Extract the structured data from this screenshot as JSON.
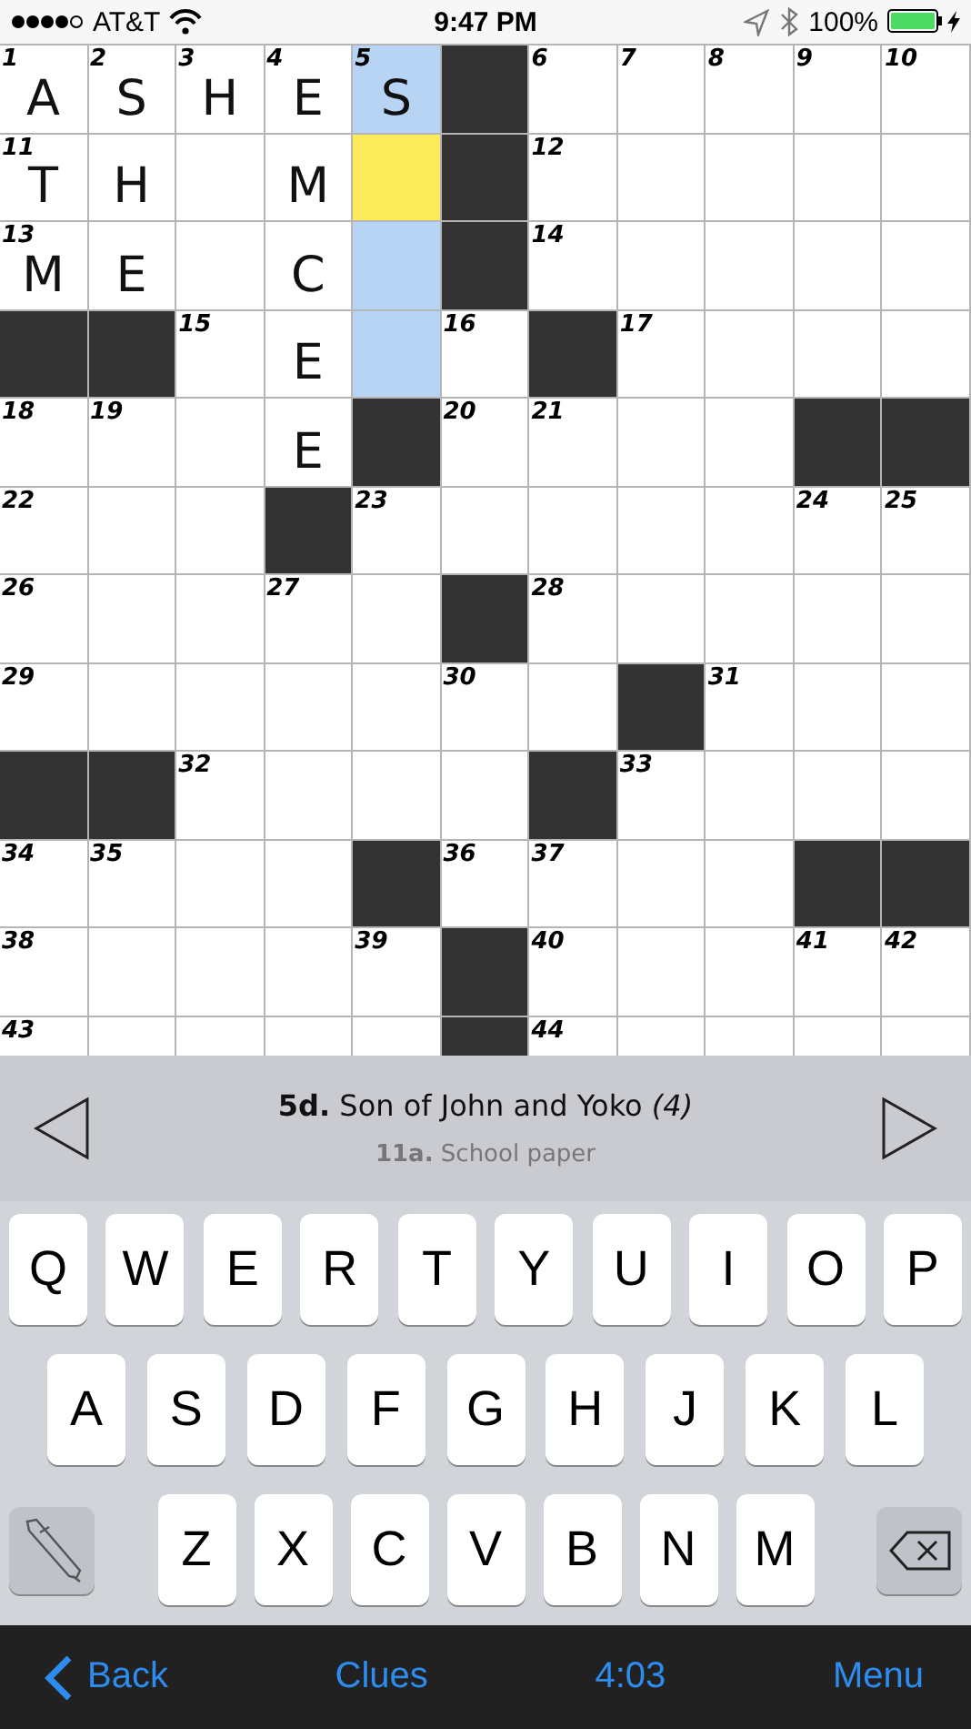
{
  "status_bar": {
    "carrier": "AT&T",
    "time": "9:47 PM",
    "battery": "100%"
  },
  "grid": {
    "rows": [
      [
        {
          "kind": "cell",
          "number": "1",
          "letter": "A",
          "selected": false,
          "highlighted": false
        },
        {
          "kind": "cell",
          "number": "2",
          "letter": "S",
          "selected": false,
          "highlighted": false
        },
        {
          "kind": "cell",
          "number": "3",
          "letter": "H",
          "selected": false,
          "highlighted": false
        },
        {
          "kind": "cell",
          "number": "4",
          "letter": "E",
          "selected": false,
          "highlighted": false
        },
        {
          "kind": "cell",
          "number": "5",
          "letter": "S",
          "selected": false,
          "highlighted": true
        },
        {
          "kind": "block"
        },
        {
          "kind": "cell",
          "number": "6",
          "selected": false,
          "highlighted": false
        },
        {
          "kind": "cell",
          "number": "7",
          "selected": false,
          "highlighted": false
        },
        {
          "kind": "cell",
          "number": "8",
          "selected": false,
          "highlighted": false
        },
        {
          "kind": "cell",
          "number": "9",
          "selected": false,
          "highlighted": false
        },
        {
          "kind": "cell",
          "number": "10",
          "selected": false,
          "highlighted": false
        }
      ],
      [
        {
          "kind": "cell",
          "number": "11",
          "letter": "T",
          "selected": false,
          "highlighted": false
        },
        {
          "kind": "cell",
          "letter": "H",
          "selected": false,
          "highlighted": false
        },
        {
          "kind": "cell",
          "selected": false,
          "highlighted": false
        },
        {
          "kind": "cell",
          "letter": "M",
          "selected": false,
          "highlighted": false
        },
        {
          "kind": "cell",
          "selected": true,
          "highlighted": false
        },
        {
          "kind": "block"
        },
        {
          "kind": "cell",
          "number": "12",
          "selected": false,
          "highlighted": false
        },
        {
          "kind": "cell",
          "selected": false,
          "highlighted": false
        },
        {
          "kind": "cell",
          "selected": false,
          "highlighted": false
        },
        {
          "kind": "cell",
          "selected": false,
          "highlighted": false
        },
        {
          "kind": "cell",
          "selected": false,
          "highlighted": false
        }
      ],
      [
        {
          "kind": "cell",
          "number": "13",
          "letter": "M",
          "selected": false,
          "highlighted": false
        },
        {
          "kind": "cell",
          "letter": "E",
          "selected": false,
          "highlighted": false
        },
        {
          "kind": "cell",
          "selected": false,
          "highlighted": false
        },
        {
          "kind": "cell",
          "letter": "C",
          "selected": false,
          "highlighted": false
        },
        {
          "kind": "cell",
          "selected": false,
          "highlighted": true
        },
        {
          "kind": "block"
        },
        {
          "kind": "cell",
          "number": "14",
          "selected": false,
          "highlighted": false
        },
        {
          "kind": "cell",
          "selected": false,
          "highlighted": false
        },
        {
          "kind": "cell",
          "selected": false,
          "highlighted": false
        },
        {
          "kind": "cell",
          "selected": false,
          "highlighted": false
        },
        {
          "kind": "cell",
          "selected": false,
          "highlighted": false
        }
      ],
      [
        {
          "kind": "block"
        },
        {
          "kind": "block"
        },
        {
          "kind": "cell",
          "number": "15",
          "selected": false,
          "highlighted": false
        },
        {
          "kind": "cell",
          "letter": "E",
          "selected": false,
          "highlighted": false
        },
        {
          "kind": "cell",
          "selected": false,
          "highlighted": true
        },
        {
          "kind": "cell",
          "number": "16",
          "selected": false,
          "highlighted": false
        },
        {
          "kind": "block"
        },
        {
          "kind": "cell",
          "number": "17",
          "selected": false,
          "highlighted": false
        },
        {
          "kind": "cell",
          "selected": false,
          "highlighted": false
        },
        {
          "kind": "cell",
          "selected": false,
          "highlighted": false
        },
        {
          "kind": "cell",
          "selected": false,
          "highlighted": false
        }
      ],
      [
        {
          "kind": "cell",
          "number": "18",
          "selected": false,
          "highlighted": false
        },
        {
          "kind": "cell",
          "number": "19",
          "selected": false,
          "highlighted": false
        },
        {
          "kind": "cell",
          "selected": false,
          "highlighted": false
        },
        {
          "kind": "cell",
          "letter": "E",
          "selected": false,
          "highlighted": false
        },
        {
          "kind": "block"
        },
        {
          "kind": "cell",
          "number": "20",
          "selected": false,
          "highlighted": false
        },
        {
          "kind": "cell",
          "number": "21",
          "selected": false,
          "highlighted": false
        },
        {
          "kind": "cell",
          "selected": false,
          "highlighted": false
        },
        {
          "kind": "cell",
          "selected": false,
          "highlighted": false
        },
        {
          "kind": "block"
        },
        {
          "kind": "block"
        }
      ],
      [
        {
          "kind": "cell",
          "number": "22",
          "selected": false,
          "highlighted": false
        },
        {
          "kind": "cell",
          "selected": false,
          "highlighted": false
        },
        {
          "kind": "cell",
          "selected": false,
          "highlighted": false
        },
        {
          "kind": "block"
        },
        {
          "kind": "cell",
          "number": "23",
          "selected": false,
          "highlighted": false
        },
        {
          "kind": "cell",
          "selected": false,
          "highlighted": false
        },
        {
          "kind": "cell",
          "selected": false,
          "highlighted": false
        },
        {
          "kind": "cell",
          "selected": false,
          "highlighted": false
        },
        {
          "kind": "cell",
          "selected": false,
          "highlighted": false
        },
        {
          "kind": "cell",
          "number": "24",
          "selected": false,
          "highlighted": false
        },
        {
          "kind": "cell",
          "number": "25",
          "selected": false,
          "highlighted": false
        }
      ],
      [
        {
          "kind": "cell",
          "number": "26",
          "selected": false,
          "highlighted": false
        },
        {
          "kind": "cell",
          "selected": false,
          "highlighted": false
        },
        {
          "kind": "cell",
          "selected": false,
          "highlighted": false
        },
        {
          "kind": "cell",
          "number": "27",
          "selected": false,
          "highlighted": false
        },
        {
          "kind": "cell",
          "selected": false,
          "highlighted": false
        },
        {
          "kind": "block"
        },
        {
          "kind": "cell",
          "number": "28",
          "selected": false,
          "highlighted": false
        },
        {
          "kind": "cell",
          "selected": false,
          "highlighted": false
        },
        {
          "kind": "cell",
          "selected": false,
          "highlighted": false
        },
        {
          "kind": "cell",
          "selected": false,
          "highlighted": false
        },
        {
          "kind": "cell",
          "selected": false,
          "highlighted": false
        }
      ],
      [
        {
          "kind": "cell",
          "number": "29",
          "selected": false,
          "highlighted": false
        },
        {
          "kind": "cell",
          "selected": false,
          "highlighted": false
        },
        {
          "kind": "cell",
          "selected": false,
          "highlighted": false
        },
        {
          "kind": "cell",
          "selected": false,
          "highlighted": false
        },
        {
          "kind": "cell",
          "selected": false,
          "highlighted": false
        },
        {
          "kind": "cell",
          "number": "30",
          "selected": false,
          "highlighted": false
        },
        {
          "kind": "cell",
          "selected": false,
          "highlighted": false
        },
        {
          "kind": "block"
        },
        {
          "kind": "cell",
          "number": "31",
          "selected": false,
          "highlighted": false
        },
        {
          "kind": "cell",
          "selected": false,
          "highlighted": false
        },
        {
          "kind": "cell",
          "selected": false,
          "highlighted": false
        }
      ],
      [
        {
          "kind": "block"
        },
        {
          "kind": "block"
        },
        {
          "kind": "cell",
          "number": "32",
          "selected": false,
          "highlighted": false
        },
        {
          "kind": "cell",
          "selected": false,
          "highlighted": false
        },
        {
          "kind": "cell",
          "selected": false,
          "highlighted": false
        },
        {
          "kind": "cell",
          "selected": false,
          "highlighted": false
        },
        {
          "kind": "block"
        },
        {
          "kind": "cell",
          "number": "33",
          "selected": false,
          "highlighted": false
        },
        {
          "kind": "cell",
          "selected": false,
          "highlighted": false
        },
        {
          "kind": "cell",
          "selected": false,
          "highlighted": false
        },
        {
          "kind": "cell",
          "selected": false,
          "highlighted": false
        }
      ],
      [
        {
          "kind": "cell",
          "number": "34",
          "selected": false,
          "highlighted": false
        },
        {
          "kind": "cell",
          "number": "35",
          "selected": false,
          "highlighted": false
        },
        {
          "kind": "cell",
          "selected": false,
          "highlighted": false
        },
        {
          "kind": "cell",
          "selected": false,
          "highlighted": false
        },
        {
          "kind": "block"
        },
        {
          "kind": "cell",
          "number": "36",
          "selected": false,
          "highlighted": false
        },
        {
          "kind": "cell",
          "number": "37",
          "selected": false,
          "highlighted": false
        },
        {
          "kind": "cell",
          "selected": false,
          "highlighted": false
        },
        {
          "kind": "cell",
          "selected": false,
          "highlighted": false
        },
        {
          "kind": "block"
        },
        {
          "kind": "block"
        }
      ],
      [
        {
          "kind": "cell",
          "number": "38",
          "selected": false,
          "highlighted": false
        },
        {
          "kind": "cell",
          "selected": false,
          "highlighted": false
        },
        {
          "kind": "cell",
          "selected": false,
          "highlighted": false
        },
        {
          "kind": "cell",
          "selected": false,
          "highlighted": false
        },
        {
          "kind": "cell",
          "number": "39",
          "selected": false,
          "highlighted": false
        },
        {
          "kind": "block"
        },
        {
          "kind": "cell",
          "number": "40",
          "selected": false,
          "highlighted": false
        },
        {
          "kind": "cell",
          "selected": false,
          "highlighted": false
        },
        {
          "kind": "cell",
          "selected": false,
          "highlighted": false
        },
        {
          "kind": "cell",
          "number": "41",
          "selected": false,
          "highlighted": false
        },
        {
          "kind": "cell",
          "number": "42",
          "selected": false,
          "highlighted": false
        }
      ],
      [
        {
          "kind": "cell",
          "number": "43",
          "selected": false,
          "highlighted": false
        },
        {
          "kind": "cell",
          "selected": false,
          "highlighted": false
        },
        {
          "kind": "cell",
          "selected": false,
          "highlighted": false
        },
        {
          "kind": "cell",
          "selected": false,
          "highlighted": false
        },
        {
          "kind": "cell",
          "selected": false,
          "highlighted": false
        },
        {
          "kind": "block"
        },
        {
          "kind": "cell",
          "number": "44",
          "selected": false,
          "highlighted": false
        },
        {
          "kind": "cell",
          "selected": false,
          "highlighted": false
        },
        {
          "kind": "cell",
          "selected": false,
          "highlighted": false
        },
        {
          "kind": "cell",
          "selected": false,
          "highlighted": false
        },
        {
          "kind": "cell",
          "selected": false,
          "highlighted": false
        }
      ]
    ]
  },
  "clue_bar": {
    "current": "**5d.** Son of John and Yoko *(4)*",
    "crossing": "**11a.** School paper"
  },
  "keyboard": {
    "rows": [
      [
        "Q",
        "W",
        "E",
        "R",
        "T",
        "Y",
        "U",
        "I",
        "O",
        "P"
      ],
      [
        "A",
        "S",
        "D",
        "F",
        "G",
        "H",
        "J",
        "K",
        "L"
      ],
      [
        "Z",
        "X",
        "C",
        "V",
        "B",
        "N",
        "M"
      ]
    ]
  },
  "toolbar": {
    "back": "Back",
    "clues": "Clues",
    "timer": "4:03",
    "menu": "Menu"
  }
}
